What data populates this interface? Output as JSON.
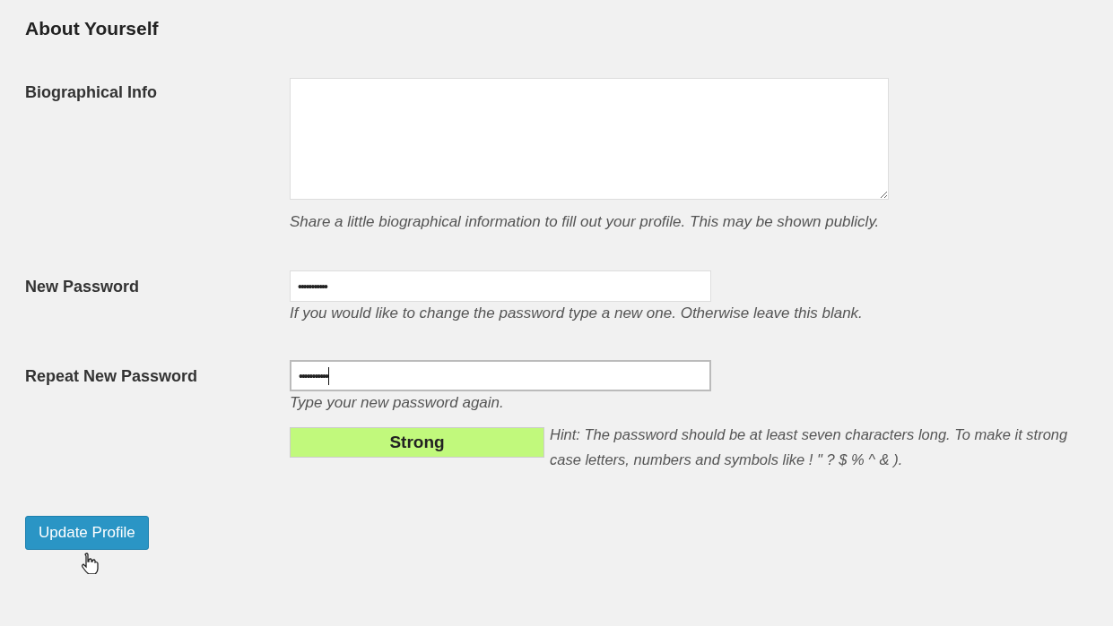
{
  "section_title": "About Yourself",
  "rows": [
    {
      "kind": "textarea",
      "label": "Biographical Info",
      "value": "",
      "focused": false,
      "description": "Share a little biographical information to fill out your profile. This may be shown publicly."
    },
    {
      "kind": "password",
      "label": "New Password",
      "value": "•••••••••••",
      "focused": false,
      "description": "If you would like to change the password type a new one. Otherwise leave this blank."
    },
    {
      "kind": "password",
      "label": "Repeat New Password",
      "value": "•••••••••••",
      "focused": true,
      "description": "Type your new password again."
    }
  ],
  "strength": {
    "kind": "strong",
    "label": "Strong"
  },
  "hint_lines": [
    "Hint: The password should be at least seven characters long. To make it strong",
    "case letters, numbers and symbols like ! \" ? $ % ^ & )."
  ],
  "submit": "Update Profile"
}
